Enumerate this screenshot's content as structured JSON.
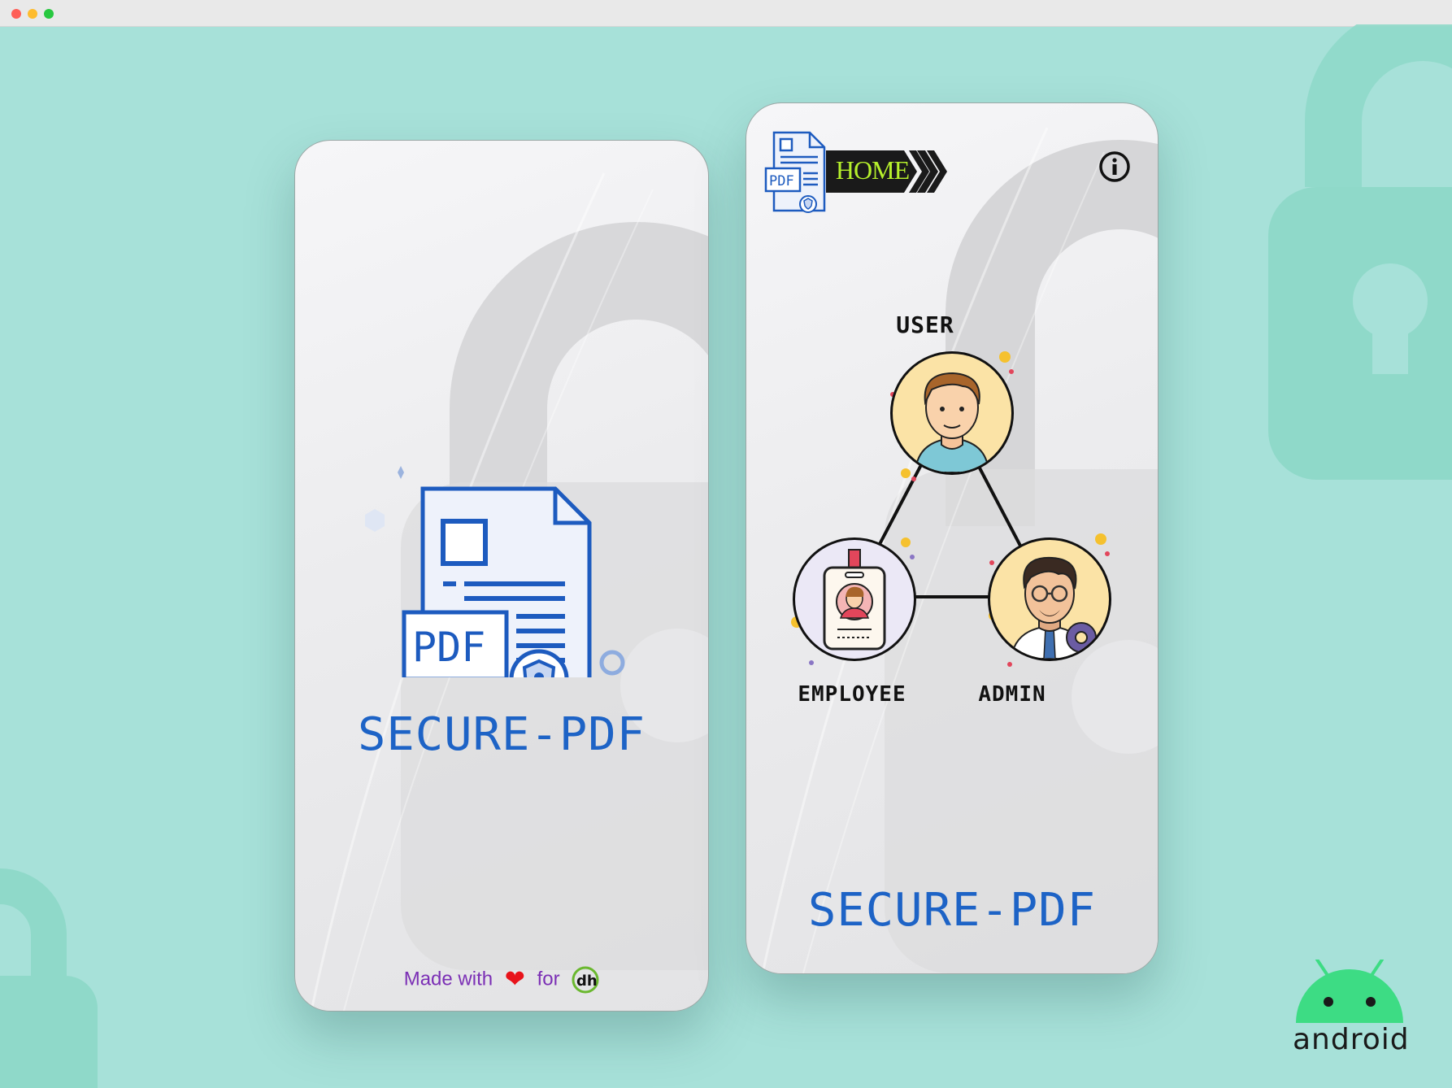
{
  "window": {
    "controls": [
      "close",
      "minimize",
      "maximize"
    ]
  },
  "splash_screen": {
    "logo_icon": "pdf-document-shield-icon",
    "logo_badge_text": "PDF",
    "title": "SECURE-PDF",
    "footer": {
      "made_with": "Made with",
      "heart_icon": "heart-icon",
      "for": "for",
      "brand_logo_text": "dh"
    }
  },
  "home_screen": {
    "header": {
      "logo_icon": "pdf-document-icon",
      "logo_badge_text": "PDF",
      "home_label": "HOME",
      "info_icon": "info-icon"
    },
    "roles": {
      "user": {
        "label": "USER",
        "icon": "user-avatar-icon"
      },
      "employee": {
        "label": "EMPLOYEE",
        "icon": "employee-id-card-icon"
      },
      "admin": {
        "label": "ADMIN",
        "icon": "admin-avatar-gear-icon"
      }
    },
    "title": "SECURE-PDF"
  },
  "branding": {
    "android_text": "android"
  },
  "colors": {
    "background": "#a7e1d9",
    "title_blue": "#1d63c6",
    "home_green": "#b6f02c",
    "made_with_purple": "#7b2fb5",
    "heart_red": "#e8131b",
    "android_green": "#3ddc84"
  }
}
